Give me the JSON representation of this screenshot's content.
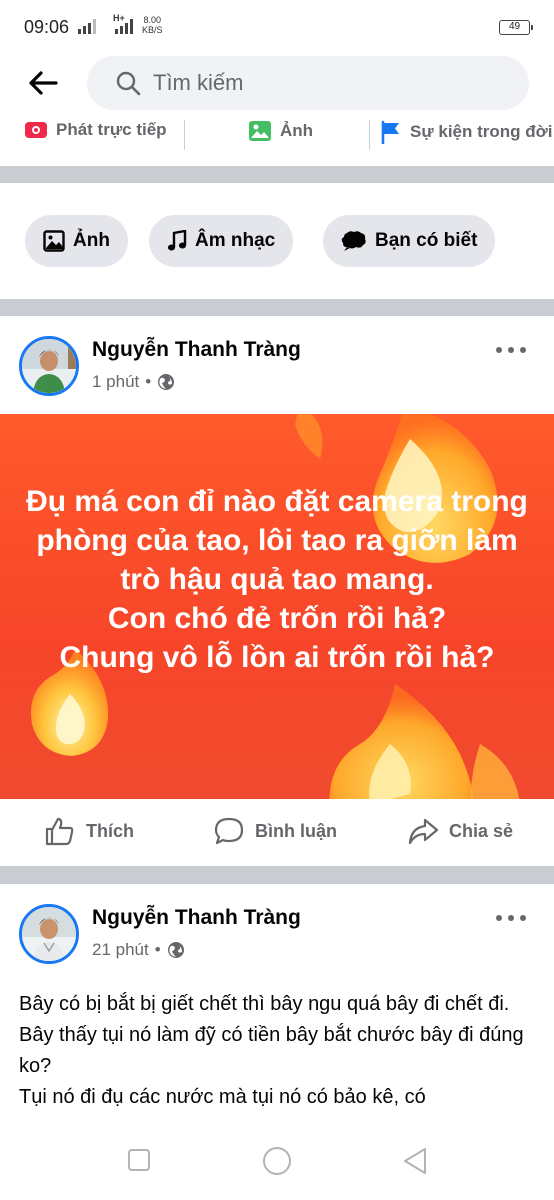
{
  "status_bar": {
    "time": "09:06",
    "net_type": "H+",
    "speed_value": "8.00",
    "speed_unit": "KB/S",
    "battery": "49"
  },
  "search": {
    "placeholder": "Tìm kiếm"
  },
  "composer": {
    "live_label": "Phát trực tiếp",
    "photo_label": "Ảnh",
    "event_label": "Sự kiện trong đời"
  },
  "chips": [
    {
      "label": "Ảnh",
      "icon": "photo-icon"
    },
    {
      "label": "Âm nhạc",
      "icon": "music-note-icon"
    },
    {
      "label": "Bạn có biết",
      "icon": "speech-bubble-icon"
    }
  ],
  "posts": [
    {
      "author": "Nguyễn Thanh Tràng",
      "time": "1 phút",
      "separator": "•",
      "privacy_icon": "globe-icon",
      "background_text": "Đụ má con đỉ nào đặt camera trong phòng của tao, lôi tao ra giỡn làm trò hậu quả tao mang.\nCon chó đẻ trốn rồi hả?\nChung vô lỗ lồn ai trốn rồi hả?",
      "background_colors": {
        "top": "#ff5a2b",
        "bottom": "#f04b2e"
      }
    },
    {
      "author": "Nguyễn Thanh Tràng",
      "time": "21 phút",
      "separator": "•",
      "privacy_icon": "globe-icon",
      "text": "Bây có bị bắt bị giết chết thì bây ngu quá bây đi chết đi.\nBây thấy tụi nó làm đỹ có tiền bây bắt chước bây đi đúng ko?\nTụi nó đi đụ các nước mà tụi nó có bảo kê, có"
    }
  ],
  "actions": {
    "like": "Thích",
    "comment": "Bình luận",
    "share": "Chia sẻ"
  },
  "colors": {
    "accent": "#1877f2",
    "live_red": "#f02849",
    "photo_green": "#45bd62",
    "event_blue": "#1877f2",
    "separator_gray": "#c9ccd1"
  }
}
